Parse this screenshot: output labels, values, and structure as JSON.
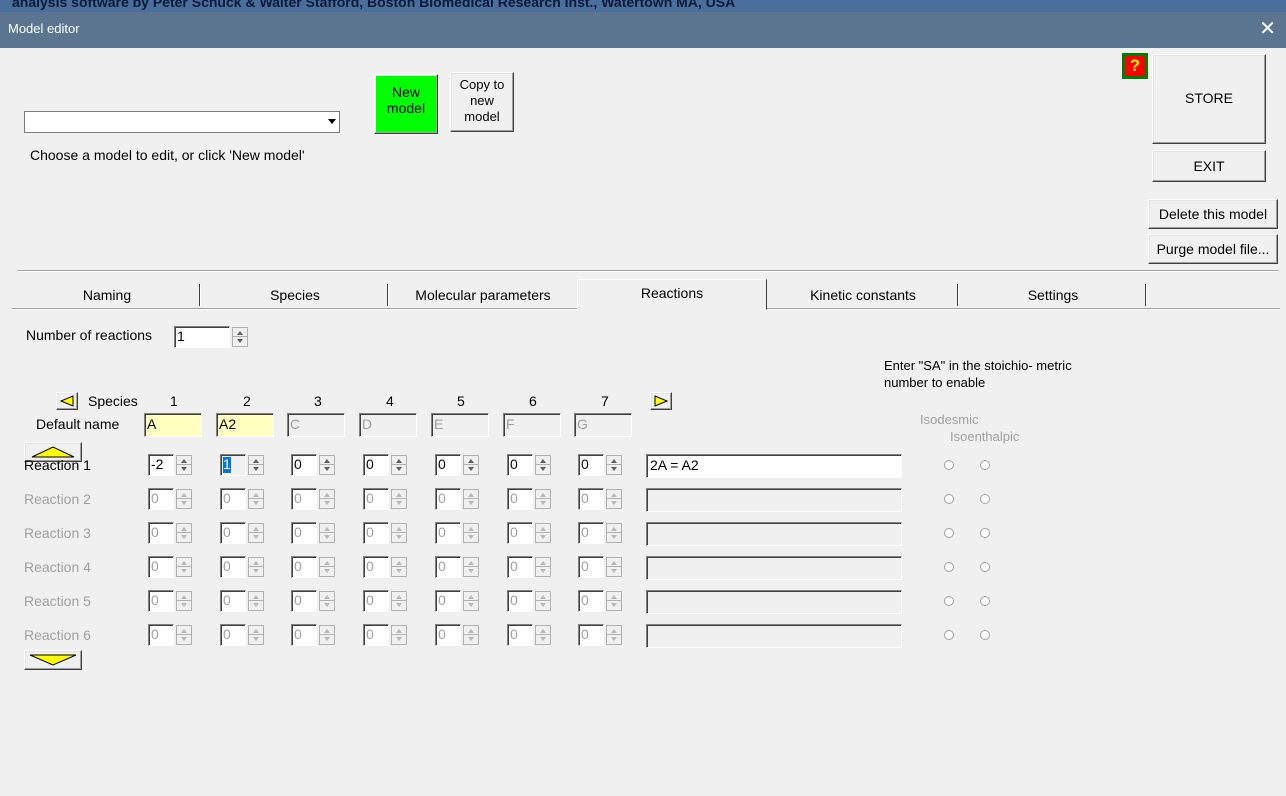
{
  "background_window": {
    "title_text": "analysis software by Peter Schuck & Walter Stafford, Boston Biomedical Research Inst., Watertown MA, USA"
  },
  "window": {
    "title": "Model editor",
    "close_glyph": "✕"
  },
  "header": {
    "model_select_value": "",
    "hint": "Choose a model to edit, or click 'New model'",
    "new_model_label": "New model",
    "copy_model_label": "Copy to new model",
    "help_glyph": "?",
    "store_label": "STORE",
    "exit_label": "EXIT",
    "delete_label": "Delete this model",
    "purge_label": "Purge model file..."
  },
  "tabs": [
    {
      "label": "Naming"
    },
    {
      "label": "Species"
    },
    {
      "label": "Molecular parameters"
    },
    {
      "label": "Reactions",
      "active": true
    },
    {
      "label": "Kinetic constants"
    },
    {
      "label": "Settings"
    }
  ],
  "reactions_tab": {
    "num_reactions_label": "Number of reactions",
    "num_reactions_value": "1",
    "sa_note": "Enter \"SA\" in the stoichio- metric number to enable",
    "isodesmic_label": "Isodesmic",
    "isoenthalpic_label": "Isoenthalpic",
    "species_label": "Species",
    "default_name_label": "Default name",
    "species_numbers": [
      "1",
      "2",
      "3",
      "4",
      "5",
      "6",
      "7"
    ],
    "default_names": [
      "A",
      "A2",
      "C",
      "D",
      "E",
      "F",
      "G"
    ],
    "reactions": [
      {
        "label": "Reaction 1",
        "coeffs": [
          "-2",
          "1",
          "0",
          "0",
          "0",
          "0",
          "0"
        ],
        "equation": "2A = A2",
        "enabled": true
      },
      {
        "label": "Reaction 2",
        "coeffs": [
          "0",
          "0",
          "0",
          "0",
          "0",
          "0",
          "0"
        ],
        "equation": "",
        "enabled": false
      },
      {
        "label": "Reaction 3",
        "coeffs": [
          "0",
          "0",
          "0",
          "0",
          "0",
          "0",
          "0"
        ],
        "equation": "",
        "enabled": false
      },
      {
        "label": "Reaction 4",
        "coeffs": [
          "0",
          "0",
          "0",
          "0",
          "0",
          "0",
          "0"
        ],
        "equation": "",
        "enabled": false
      },
      {
        "label": "Reaction 5",
        "coeffs": [
          "0",
          "0",
          "0",
          "0",
          "0",
          "0",
          "0"
        ],
        "equation": "",
        "enabled": false
      },
      {
        "label": "Reaction 6",
        "coeffs": [
          "0",
          "0",
          "0",
          "0",
          "0",
          "0",
          "0"
        ],
        "equation": "",
        "enabled": false
      }
    ]
  },
  "colors": {
    "new_model_bg": "#00ff00",
    "help_bg": "#ff0000",
    "name_highlight": "#ffffc0",
    "arrow_fill": "#ffff00"
  }
}
